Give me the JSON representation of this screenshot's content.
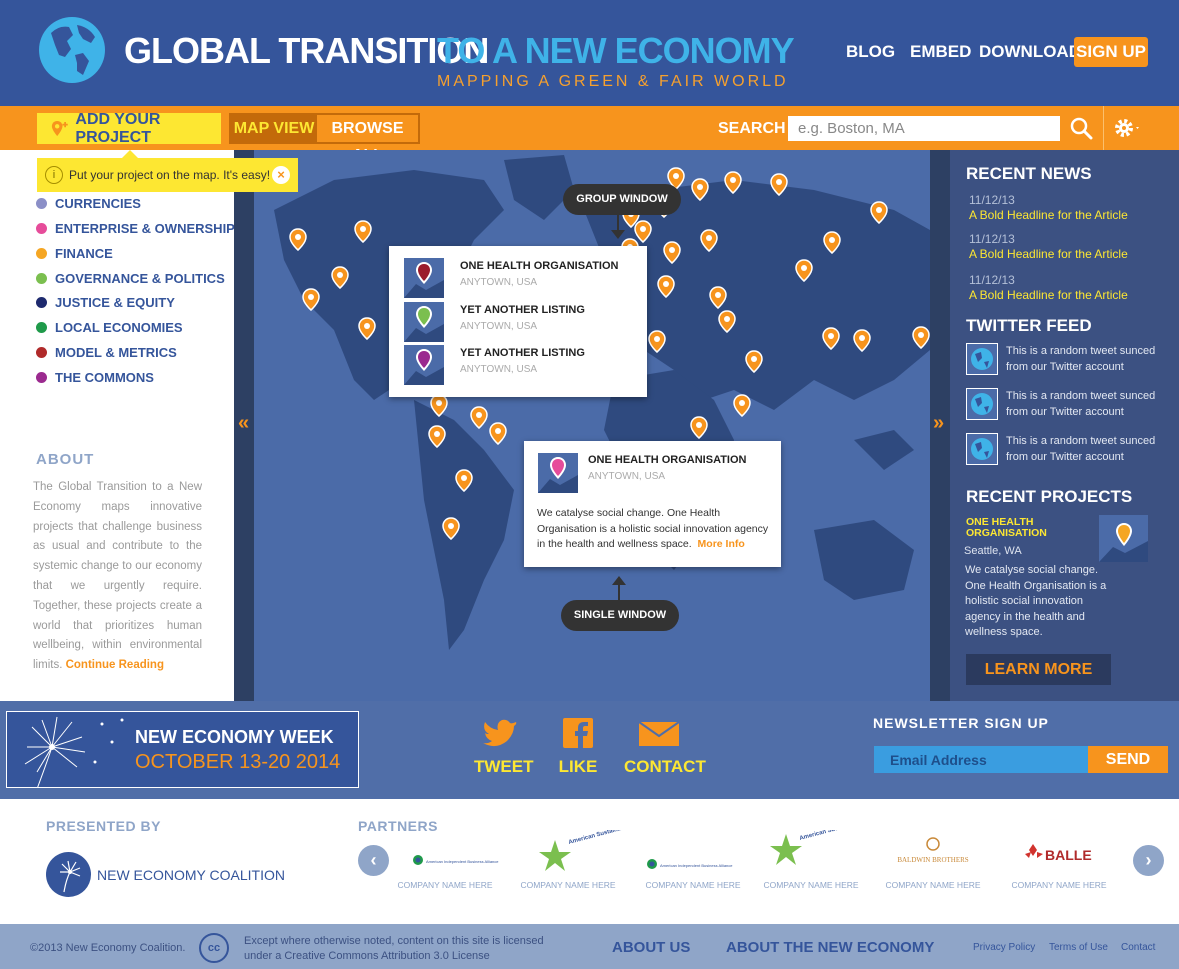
{
  "header": {
    "title_part1": "GLOBAL TRANSITION",
    "title_part2": "TO A NEW ECONOMY",
    "subtitle": "MAPPING A GREEN & FAIR WORLD",
    "nav": [
      "BLOG",
      "EMBED",
      "DOWNLOAD"
    ],
    "signup": "SIGN UP"
  },
  "toolbar": {
    "add_project": "ADD YOUR PROJECT",
    "map_view": "MAP VIEW",
    "browse_all": "BROWSE ALL",
    "search_label": "SEARCH",
    "search_placeholder": "e.g. Boston, MA"
  },
  "tooltip": {
    "icon": "i",
    "text": "Put your project on the map. It's easy!",
    "close": "×"
  },
  "categories": [
    {
      "label": "CURRENCIES",
      "color": "#8b8fc7"
    },
    {
      "label": "ENTERPRISE & OWNERSHIP",
      "color": "#e64c9a"
    },
    {
      "label": "FINANCE",
      "color": "#f5a623"
    },
    {
      "label": "GOVERNANCE & POLITICS",
      "color": "#7bbf4f"
    },
    {
      "label": "JUSTICE & EQUITY",
      "color": "#1e2a6e"
    },
    {
      "label": "LOCAL ECONOMIES",
      "color": "#1f9a4a"
    },
    {
      "label": "MODEL & METRICS",
      "color": "#b02a2a"
    },
    {
      "label": "THE COMMONS",
      "color": "#9b2a8f"
    }
  ],
  "about": {
    "heading": "ABOUT",
    "text": "The Global Transition to a New Economy maps innovative projects that challenge business as usual and contribute to the systemic change to our economy that we urgently require. Together, these projects create a world that prioritizes human wellbeing, within environmental limits.",
    "continue": "Continue Reading"
  },
  "map": {
    "arrow_left": "«",
    "arrow_right": "»",
    "group_window_label": "GROUP WINDOW",
    "single_window_label": "SINGLE WINDOW",
    "group_items": [
      {
        "name": "ONE HEALTH ORGANISATION",
        "location": "ANYTOWN, USA",
        "pin_color": "#9b1c2c"
      },
      {
        "name": "YET ANOTHER LISTING",
        "location": "ANYTOWN, USA",
        "pin_color": "#7bbf4f"
      },
      {
        "name": "YET ANOTHER LISTING",
        "location": "ANYTOWN, USA",
        "pin_color": "#9b2a8f"
      }
    ],
    "single": {
      "name": "ONE HEALTH ORGANISATION",
      "location": "ANYTOWN, USA",
      "description": "We catalyse social change. One Health Organisation is a holistic social innovation agency in the health and wellness space.",
      "more_info": "More Info",
      "pin_color": "#e64c9a"
    }
  },
  "recent_news": {
    "heading": "RECENT NEWS",
    "items": [
      {
        "date": "11/12/13",
        "headline": "A Bold Headline for the Article"
      },
      {
        "date": "11/12/13",
        "headline": "A Bold Headline for the Article"
      },
      {
        "date": "11/12/13",
        "headline": "A Bold Headline for the Article"
      }
    ]
  },
  "twitter": {
    "heading": "TWITTER FEED",
    "tweets": [
      "This is a random tweet sunced from our Twitter account",
      "This is a random tweet sunced from our Twitter account",
      "This is a random tweet sunced from our Twitter account"
    ]
  },
  "recent_projects": {
    "heading": "RECENT PROJECTS",
    "name": "ONE HEALTH ORGANISATION",
    "location": "Seattle, WA",
    "description": "We catalyse social change. One Health Organisation is a holistic social innovation agency in the health and wellness space.",
    "learn_more": "LEARN MORE"
  },
  "event_banner": {
    "title": "NEW ECONOMY WEEK",
    "dates": "OCTOBER 13-20 2014"
  },
  "social": [
    {
      "label": "TWEET",
      "icon": "twitter-icon"
    },
    {
      "label": "LIKE",
      "icon": "facebook-icon"
    },
    {
      "label": "CONTACT",
      "icon": "envelope-icon"
    }
  ],
  "newsletter": {
    "heading": "NEWSLETTER SIGN UP",
    "placeholder": "Email Address",
    "send": "SEND"
  },
  "presented_by": {
    "heading": "PRESENTED BY",
    "name": "NEW ECONOMY COALITION"
  },
  "partners": {
    "heading": "PARTNERS",
    "items": [
      {
        "logo": "American Independent Business Alliance",
        "name": "COMPANY NAME HERE"
      },
      {
        "logo": "American Sustainable Business Council",
        "name": "COMPANY NAME HERE"
      },
      {
        "logo": "American Independent Business Alliance",
        "name": "COMPANY NAME HERE"
      },
      {
        "logo": "American Sustainable Business Council",
        "name": "COMPANY NAME HERE"
      },
      {
        "logo": "BALDWIN BROTHERS",
        "name": "COMPANY NAME HERE"
      },
      {
        "logo": "BALLE",
        "name": "COMPANY NAME HERE"
      }
    ],
    "prev": "‹",
    "next": "›"
  },
  "footer": {
    "copyright": "©2013 New Economy Coalition.",
    "cc": "cc",
    "license": "Except where otherwise noted, content on this site is licensed under a Creative Commons Attribution 3.0 License",
    "about_us": "ABOUT US",
    "about_new_economy": "ABOUT THE NEW ECONOMY",
    "privacy": "Privacy Policy",
    "terms": "Terms of Use",
    "contact": "Contact"
  },
  "colors": {
    "brand_blue": "#35559b",
    "accent_orange": "#f7941d",
    "highlight_yellow": "#fde732",
    "map_ocean": "#4b6ba8"
  }
}
